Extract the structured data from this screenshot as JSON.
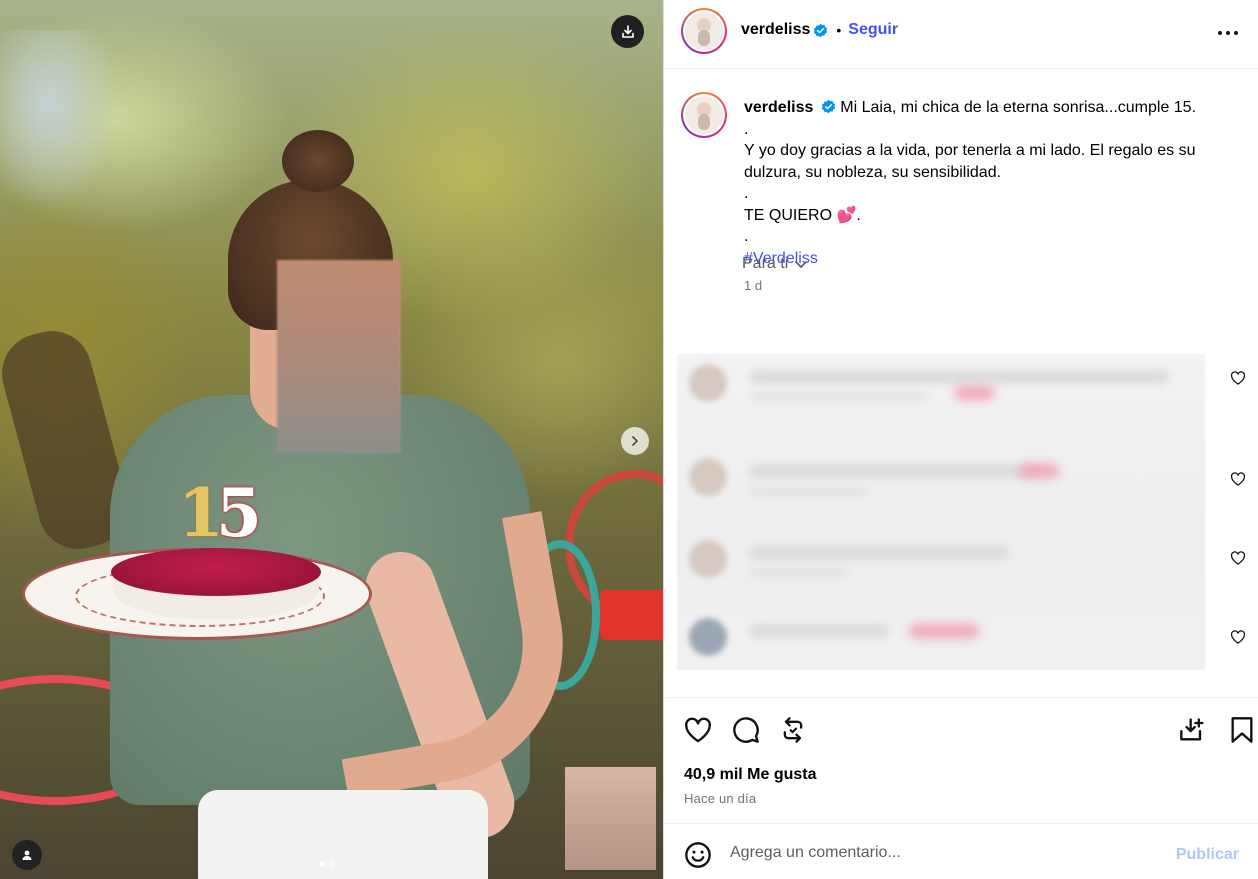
{
  "post": {
    "username": "verdeliss",
    "follow_label": "Seguir",
    "separator": "•",
    "caption_lines": [
      "Mi Laia, mi chica de la eterna sonrisa...cumple 15.",
      ".",
      "Y yo doy gracias a la vida, por tenerla a mi lado. El regalo es su dulzura, su nobleza, su sensibilidad.",
      ".",
      "TE QUIERO 💕.",
      "."
    ],
    "hashtag": "#Verdeliss",
    "time_short": "1 d",
    "sort_label": "Para ti",
    "likes": "40,9 mil Me gusta",
    "time_long": "Hace un día"
  },
  "media": {
    "candle_digits": [
      "1",
      "5"
    ],
    "carousel_index": 1,
    "carousel_total": 2
  },
  "comment_box": {
    "placeholder": "Agrega un comentario...",
    "publish_label": "Publicar"
  },
  "icons": {
    "verified": "verified-badge-icon",
    "more": "more-options-icon",
    "download": "download-icon",
    "next": "chevron-right-icon",
    "tag": "user-tag-icon",
    "like": "heart-icon",
    "comment": "comment-icon",
    "repost": "repost-icon",
    "save": "bookmark-icon",
    "emoji": "emoji-icon"
  },
  "colors": {
    "link_blue": "#4150f7",
    "verified_blue": "#0095f6",
    "publish_disabled": "#b3c5f6"
  }
}
